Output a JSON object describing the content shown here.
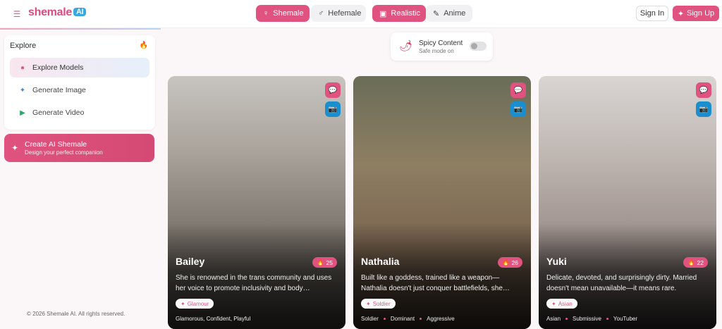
{
  "header": {
    "logo_text": "shemale",
    "logo_ai": "AI",
    "gender_tabs": [
      {
        "label": "Shemale",
        "icon": "female-icon",
        "active": true
      },
      {
        "label": "Hefemale",
        "icon": "male-icon",
        "active": false
      }
    ],
    "style_tabs": [
      {
        "label": "Realistic",
        "icon": "camera-icon",
        "active": true
      },
      {
        "label": "Anime",
        "icon": "brush-icon",
        "active": false
      }
    ],
    "signin": "Sign In",
    "signup": "Sign Up"
  },
  "sidebar": {
    "explore_title": "Explore",
    "items": [
      {
        "label": "Explore Models",
        "icon": "compass-icon",
        "active": true
      },
      {
        "label": "Generate Image",
        "icon": "sparkle-icon",
        "active": false
      },
      {
        "label": "Generate Video",
        "icon": "video-icon",
        "active": false
      }
    ],
    "create": {
      "title": "Create AI Shemale",
      "subtitle": "Design your perfect companion"
    },
    "copyright": "© 2026 Shemale AI. All rights reserved."
  },
  "spicy": {
    "title": "Spicy Content",
    "subtitle": "Safe mode on",
    "enabled": false
  },
  "cards": [
    {
      "name": "Bailey",
      "count": "25",
      "description": "She is renowned in the trans community and uses her voice to promote inclusivity and body…",
      "category": "Glamour",
      "tags": [
        "Glamorous, Confident, Playful"
      ]
    },
    {
      "name": "Nathalia",
      "count": "26",
      "description": "Built like a goddess, trained like a weapon—Nathalia doesn't just conquer battlefields, she…",
      "category": "Soldier",
      "tags": [
        "Soldier",
        "Dominant",
        "Aggressive"
      ]
    },
    {
      "name": "Yuki",
      "count": "22",
      "description": "Delicate, devoted, and surprisingly dirty. Married doesn't mean unavailable—it means rare.",
      "category": "Asian",
      "tags": [
        "Asian",
        "Submissive",
        "YouTuber"
      ]
    }
  ],
  "colors": {
    "accent": "#e0527f",
    "blue": "#1a8fd0"
  }
}
